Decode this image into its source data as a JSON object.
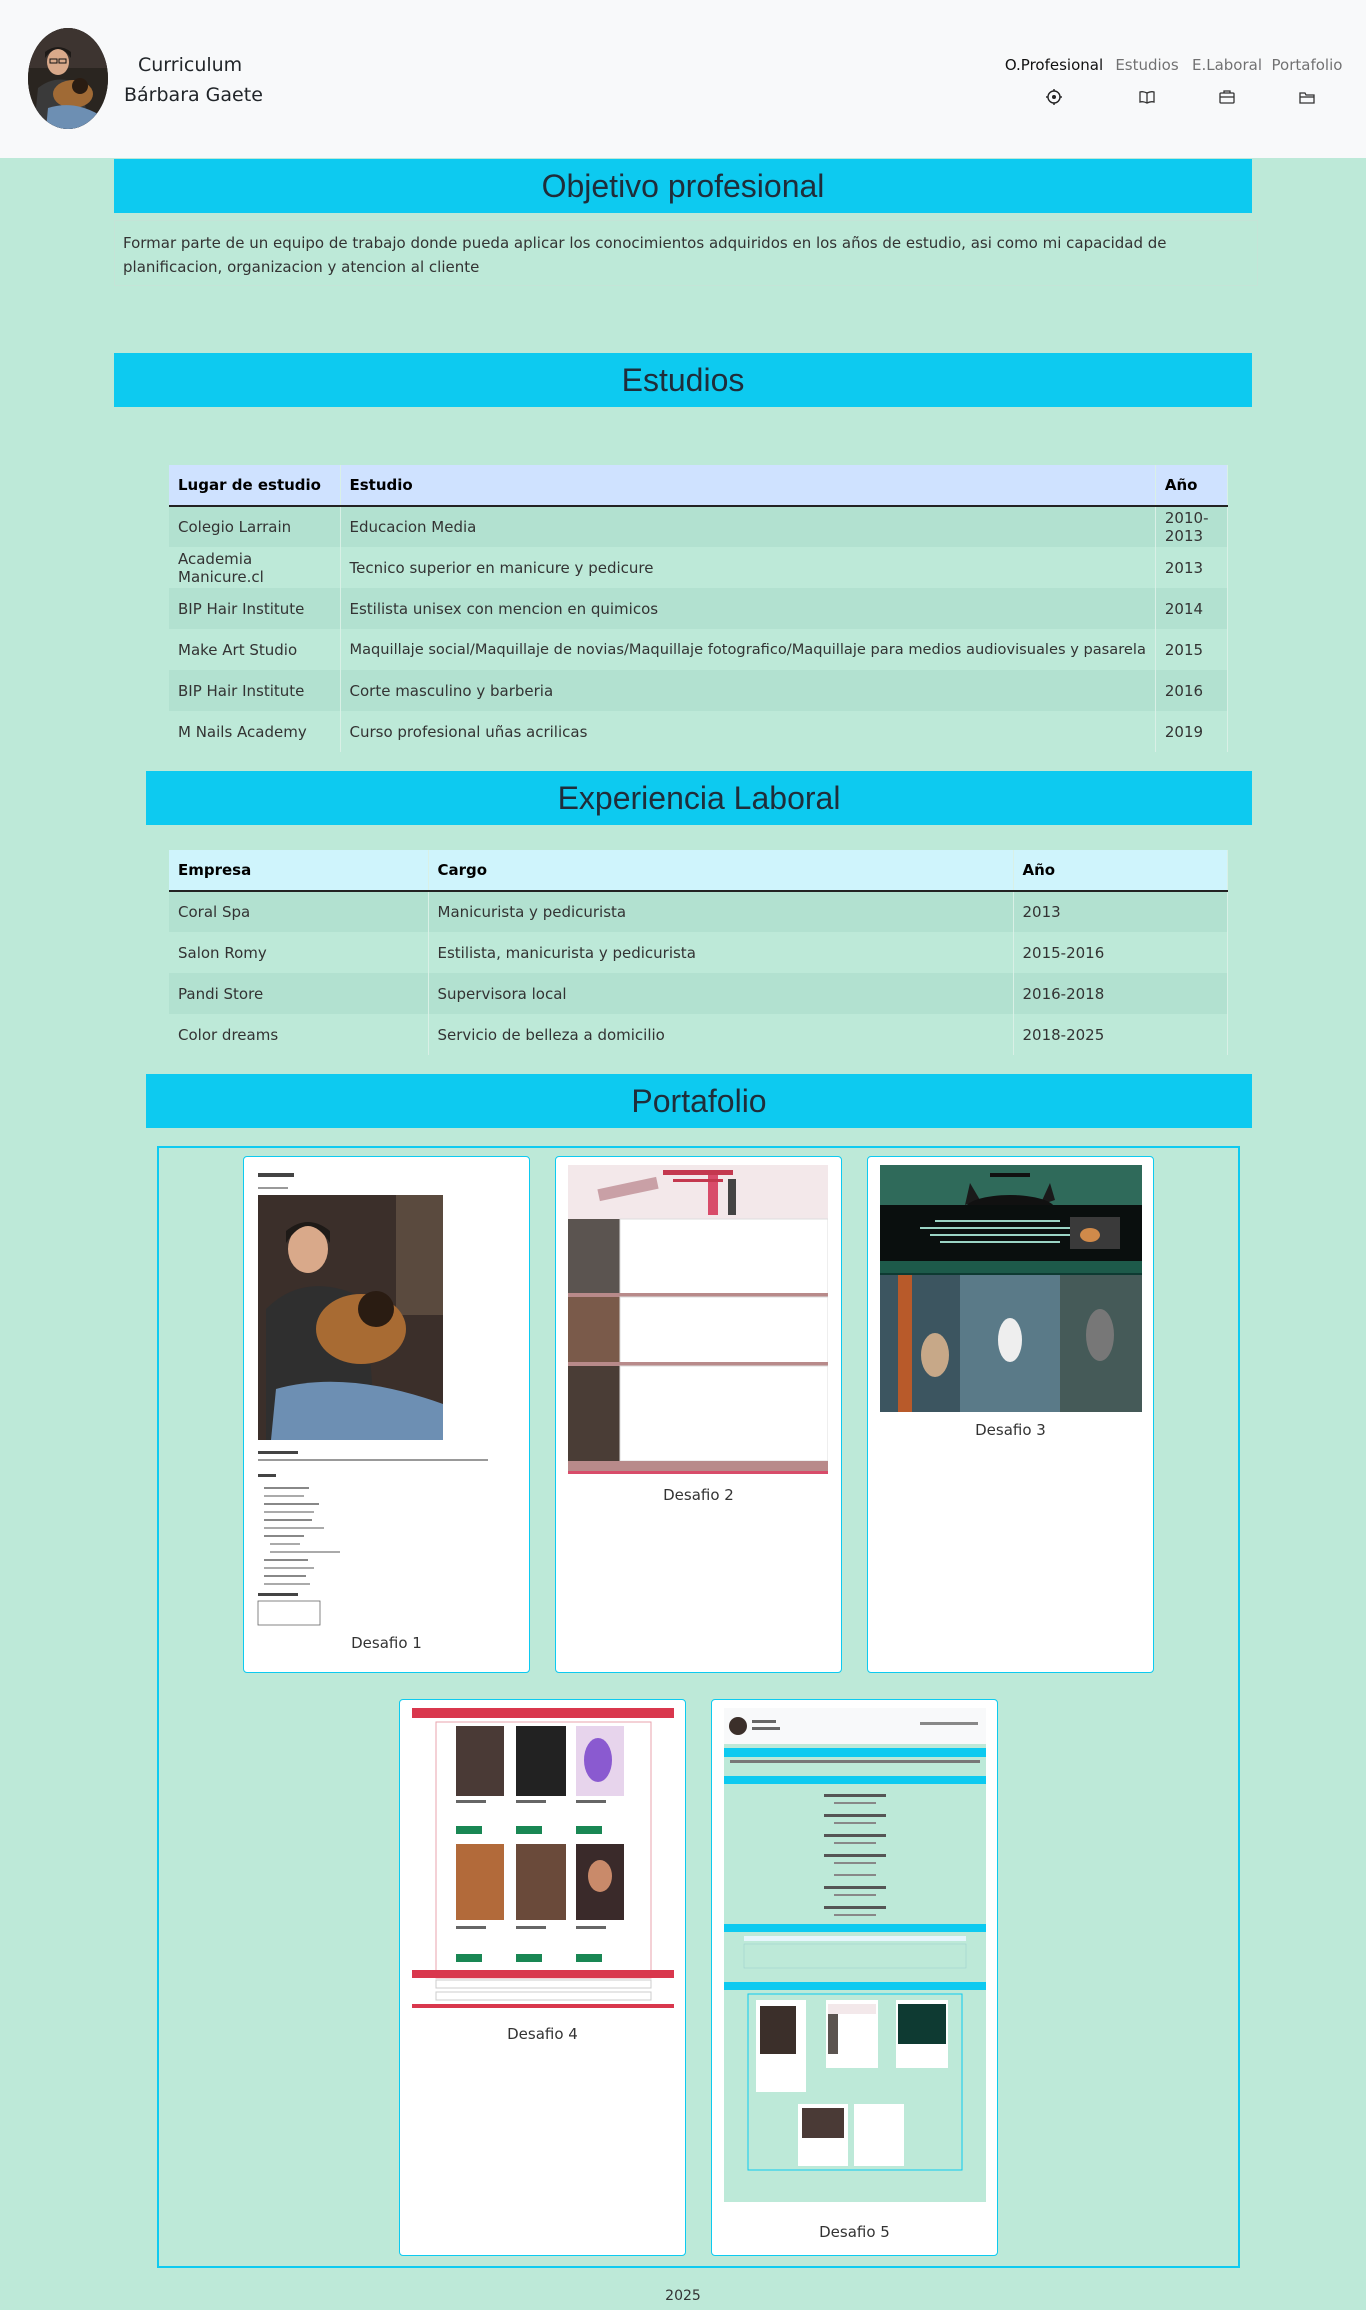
{
  "header": {
    "brand_line1": "Curriculum",
    "brand_line2": "Bárbara Gaete",
    "nav": [
      {
        "label": "O.Profesional",
        "icon": "target-icon"
      },
      {
        "label": "Estudios",
        "icon": "book-icon"
      },
      {
        "label": "E.Laboral",
        "icon": "briefcase-icon"
      },
      {
        "label": "Portafolio",
        "icon": "folder-icon"
      }
    ]
  },
  "objective": {
    "title": "Objetivo profesional",
    "text": "Formar parte de un equipo de trabajo donde pueda aplicar los conocimientos adquiridos en los años de estudio, asi como mi capacidad de planificacion, organizacion y atencion al cliente"
  },
  "studies": {
    "title": "Estudios",
    "headers": [
      "Lugar de estudio",
      "Estudio",
      "Año"
    ],
    "rows": [
      [
        "Colegio Larrain",
        "Educacion Media",
        "2010-2013"
      ],
      [
        "Academia Manicure.cl",
        "Tecnico superior en manicure y pedicure",
        "2013"
      ],
      [
        "BIP Hair Institute",
        "Estilista unisex con mencion en quimicos",
        "2014"
      ],
      [
        "Make Art Studio",
        "Maquillaje social/Maquillaje de novias/Maquillaje fotografico/Maquillaje para medios audiovisuales y pasarela",
        "2015"
      ],
      [
        "BIP Hair Institute",
        "Corte masculino y barberia",
        "2016"
      ],
      [
        "M Nails Academy",
        "Curso profesional uñas acrilicas",
        "2019"
      ]
    ]
  },
  "work": {
    "title": "Experiencia Laboral",
    "headers": [
      "Empresa",
      "Cargo",
      "Año"
    ],
    "rows": [
      [
        "Coral Spa",
        "Manicurista y pedicurista",
        "2013"
      ],
      [
        "Salon Romy",
        "Estilista, manicurista y pedicurista",
        "2015-2016"
      ],
      [
        "Pandi Store",
        "Supervisora local",
        "2016-2018"
      ],
      [
        "Color dreams",
        "Servicio de belleza a domicilio",
        "2018-2025"
      ]
    ]
  },
  "portfolio": {
    "title": "Portafolio",
    "items": [
      {
        "caption": "Desafio 1"
      },
      {
        "caption": "Desafio 2"
      },
      {
        "caption": "Desafio 3"
      },
      {
        "caption": "Desafio 4"
      },
      {
        "caption": "Desafio 5"
      }
    ]
  },
  "footer": {
    "text": "2025"
  },
  "colors": {
    "banner": "#0dcaf0",
    "background": "#bde9d8",
    "navbar": "#f8f9fa"
  }
}
